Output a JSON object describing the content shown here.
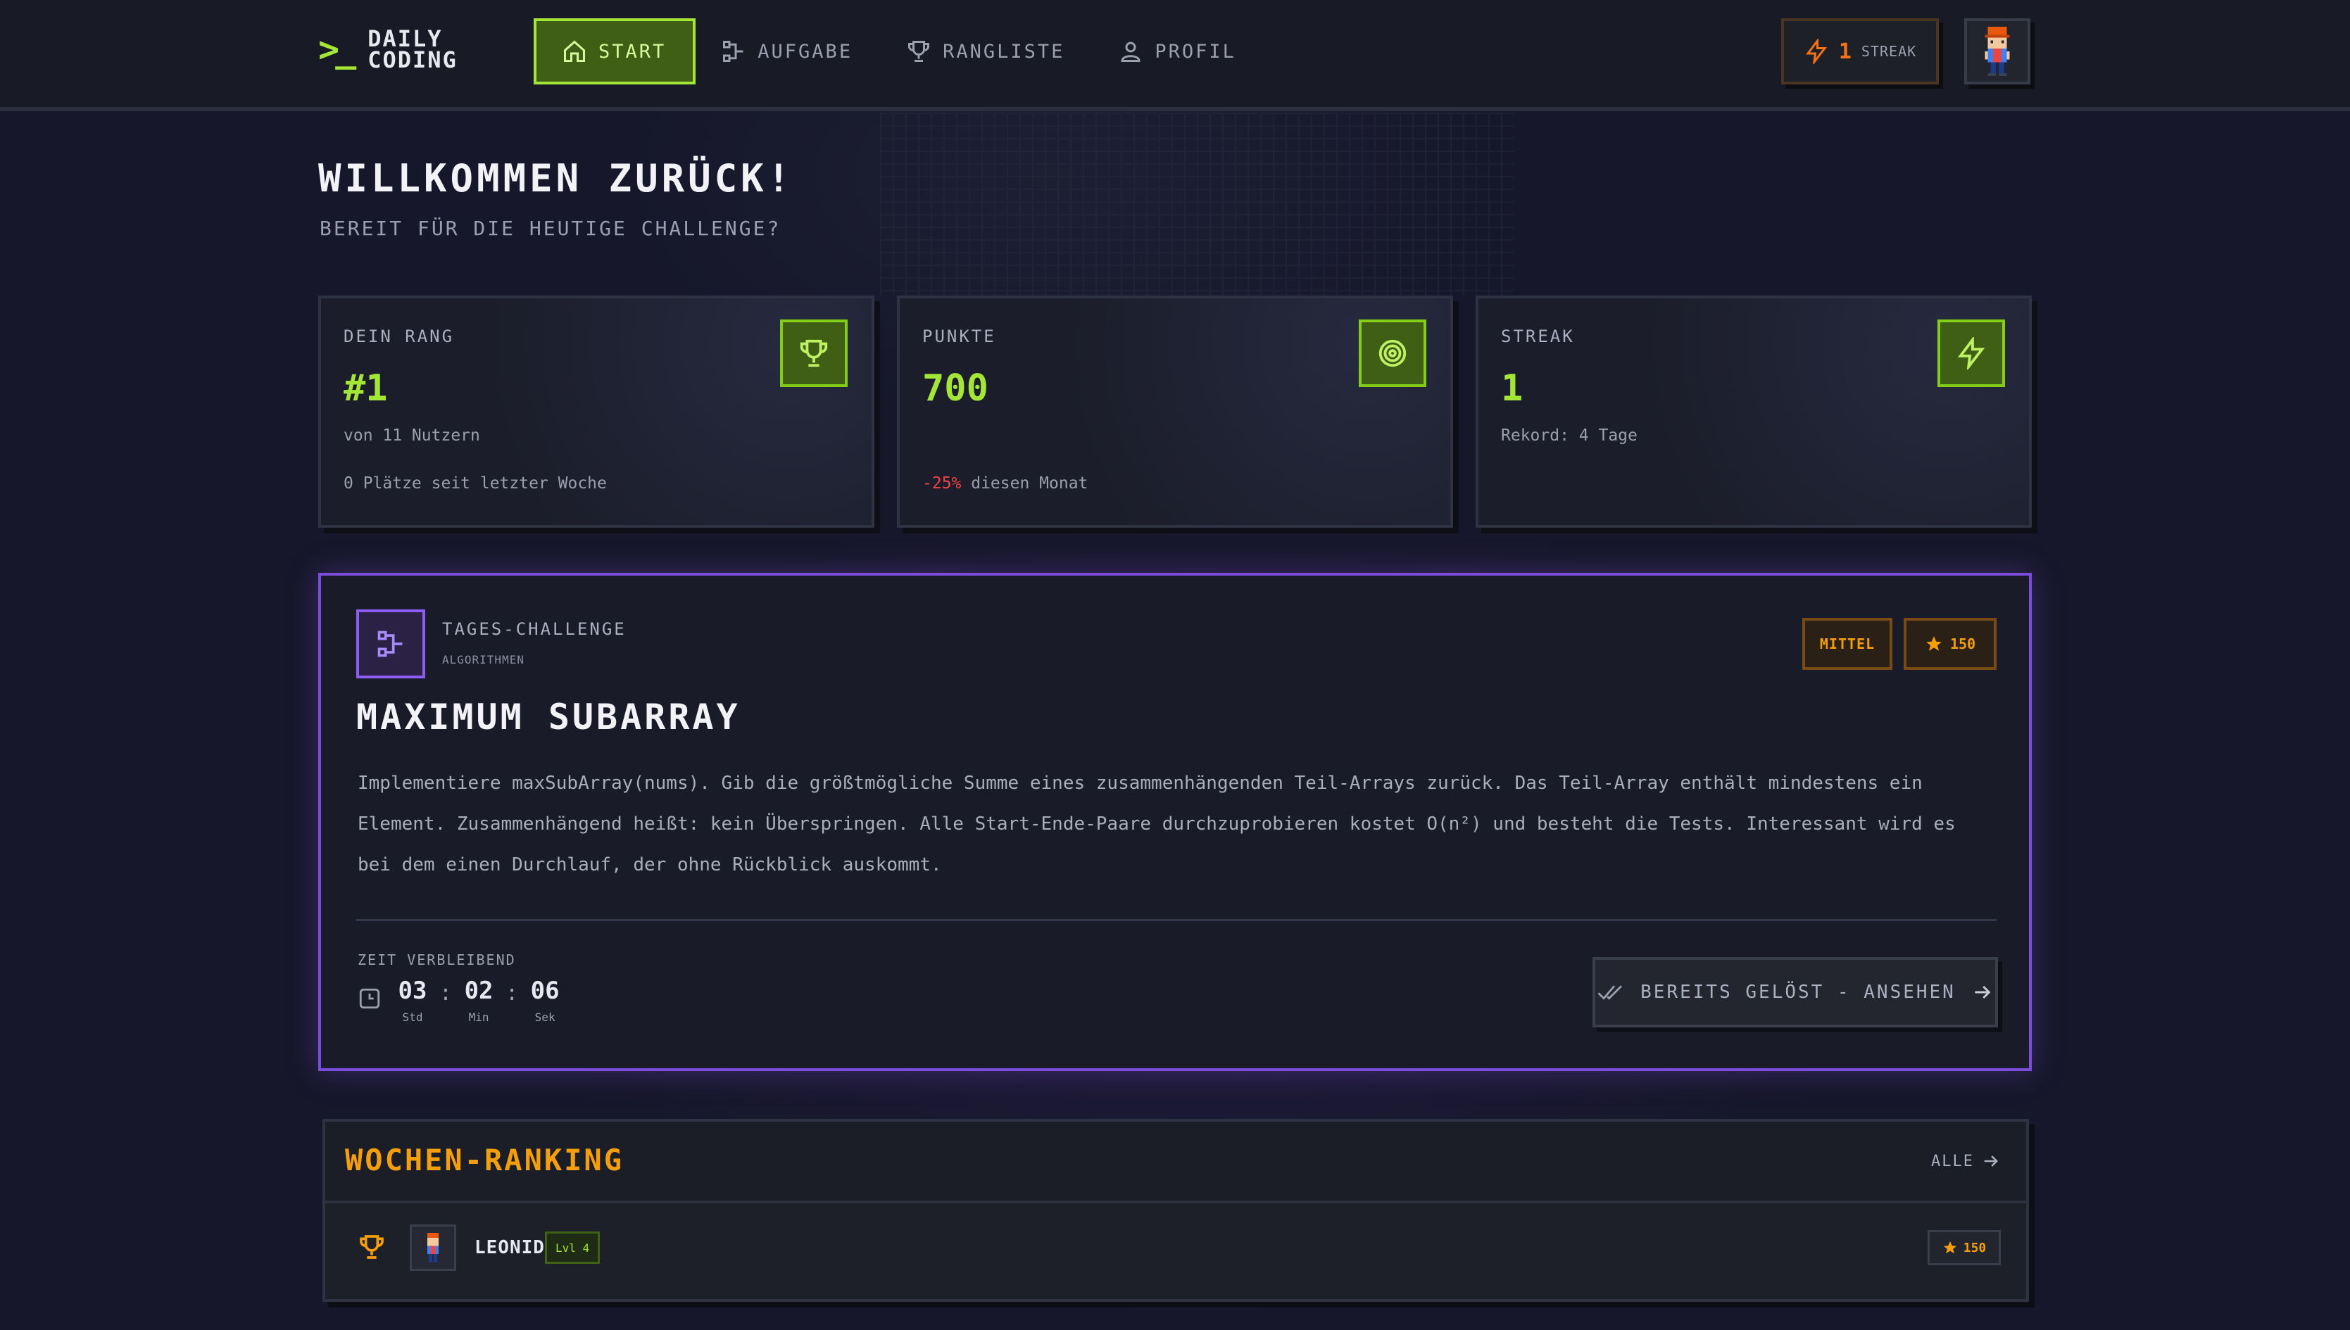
{
  "header": {
    "logo_mark": ">_",
    "logo_line1": "DAILY",
    "logo_line2": "CODING",
    "nav": [
      {
        "label": "START",
        "icon": "home-icon",
        "active": true
      },
      {
        "label": "AUFGABE",
        "icon": "flow-icon",
        "active": false
      },
      {
        "label": "RANGLISTE",
        "icon": "trophy-icon",
        "active": false
      },
      {
        "label": "PROFIL",
        "icon": "user-icon",
        "active": false
      }
    ],
    "streak_count": "1",
    "streak_label": "STREAK"
  },
  "welcome": {
    "title": "WILLKOMMEN ZURÜCK!",
    "subtitle": "BEREIT FÜR DIE HEUTIGE CHALLENGE?"
  },
  "stats": [
    {
      "label": "DEIN RANG",
      "value": "#1",
      "sub": "von 11 Nutzern",
      "note": "0 Plätze seit letzter Woche",
      "icon": "trophy-icon"
    },
    {
      "label": "PUNKTE",
      "value": "700",
      "sub": "",
      "note_neg": "-25%",
      "note": " diesen Monat",
      "icon": "target-icon"
    },
    {
      "label": "STREAK",
      "value": "1",
      "sub": "Rekord: 4 Tage",
      "note": "",
      "icon": "bolt-icon"
    }
  ],
  "challenge": {
    "kicker": "TAGES-CHALLENGE",
    "category": "ALGORITHMEN",
    "difficulty": "MITTEL",
    "points": "150",
    "title": "MAXIMUM SUBARRAY",
    "description": "Implementiere maxSubArray(nums). Gib die größtmögliche Summe eines zusammenhängenden Teil-Arrays zurück. Das Teil-Array enthält mindestens ein Element. Zusammenhängend heißt: kein Überspringen. Alle Start-Ende-Paare durchzuprobieren kostet O(n²) und besteht die Tests. Interessant wird es bei dem einen Durchlauf, der ohne Rückblick auskommt.",
    "timer_label": "ZEIT VERBLEIBEND",
    "hours": "03",
    "minutes": "02",
    "seconds": "06",
    "hours_label": "Std",
    "minutes_label": "Min",
    "seconds_label": "Sek",
    "solved_button": "BEREITS GELÖST - ANSEHEN"
  },
  "ranking": {
    "title": "WOCHEN-RANKING",
    "all_link": "ALLE",
    "rows": [
      {
        "name": "LEONID",
        "level": "Lvl 4",
        "points": "150"
      }
    ]
  },
  "colors": {
    "accent_green": "#a3e635",
    "accent_purple": "#8b5cf6",
    "accent_orange": "#f59e0b",
    "streak_orange": "#f97316",
    "negative_red": "#ef4444"
  }
}
